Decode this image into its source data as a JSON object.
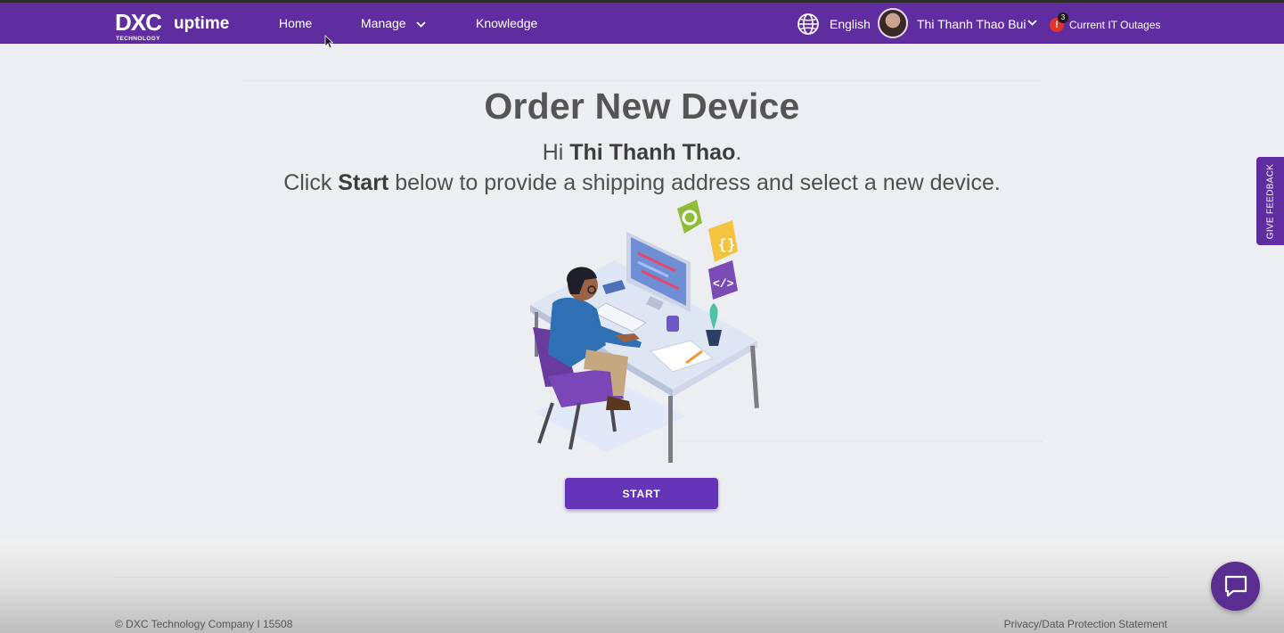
{
  "header": {
    "logo_dxc": "DXC",
    "logo_technology": "TECHNOLOGY",
    "logo_uptime": "uptime",
    "nav": {
      "home": "Home",
      "manage": "Manage",
      "knowledge": "Knowledge"
    },
    "language": "English",
    "user_name": "Thi Thanh Thao Bui",
    "outages_label": "Current IT Outages",
    "outages_count": "3",
    "outages_alert": "!"
  },
  "main": {
    "title": "Order New Device",
    "greeting_prefix": "Hi ",
    "greeting_name": "Thi Thanh Thao",
    "greeting_suffix": ".",
    "instruction_prefix": "Click ",
    "instruction_strong": "Start",
    "instruction_suffix": " below to provide a shipping address and select a new device.",
    "start_button": "START"
  },
  "feedback_tab": "GIVE FEEDBACK",
  "footer": {
    "copyright": "© DXC Technology Company I 15508",
    "privacy": "Privacy/Data Protection Statement"
  },
  "colors": {
    "brand_purple": "#5f2da0",
    "button_purple": "#6535b7",
    "page_bg": "#edeef2",
    "alert_red": "#e2342d"
  },
  "icons": [
    "globe-icon",
    "chevron-down-icon",
    "alert-icon",
    "chat-icon",
    "mouse-cursor-icon"
  ]
}
